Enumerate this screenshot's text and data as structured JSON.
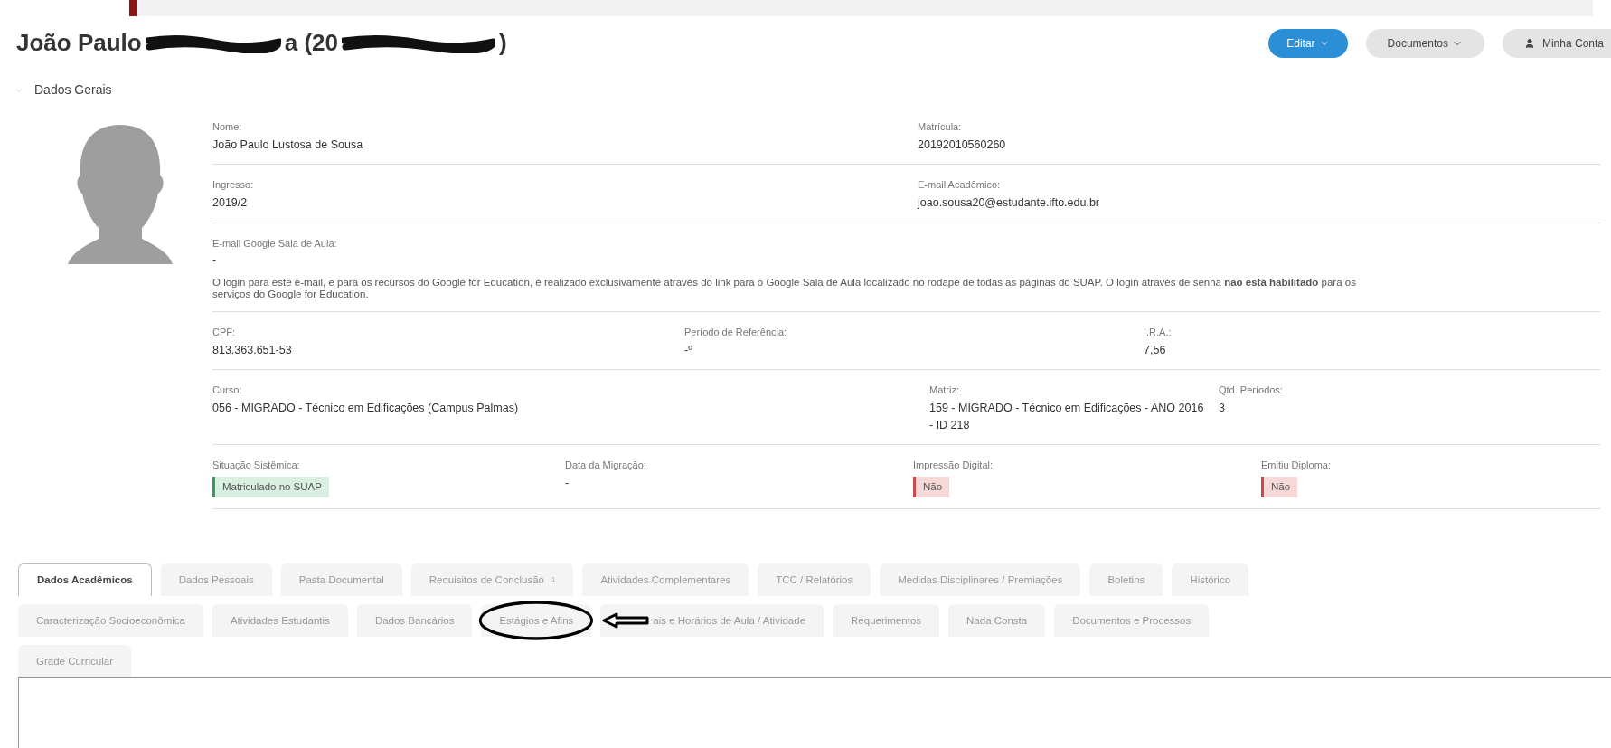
{
  "header": {
    "title_parts": [
      "João Paulo",
      "a (20",
      ")"
    ],
    "buttons": [
      {
        "label": "Editar",
        "kind": "primary"
      },
      {
        "label": "Documentos",
        "kind": "dropdown"
      },
      {
        "label": "Minha Conta",
        "kind": "account"
      }
    ]
  },
  "section": {
    "title": "Dados Gerais",
    "expanded": true
  },
  "rows": [
    {
      "fields": [
        {
          "label": "Nome:",
          "value": "João Paulo Lustosa de Sousa"
        },
        {
          "label": "Matrícula:",
          "value": "20192010560260"
        }
      ]
    },
    {
      "fields": [
        {
          "label": "Ingresso:",
          "value": "2019/2"
        },
        {
          "label": "E-mail Acadêmico:",
          "value": "joao.sousa20@estudante.ifto.edu.br"
        }
      ]
    },
    {
      "fields": [
        {
          "label": "E-mail Google Sala de Aula:",
          "value": "-",
          "note": "O login para este e-mail, e para os recursos do Google for Education, é realizado exclusivamente através do link para o Google Sala de Aula localizado no rodapé de todas as páginas do SUAP. O login através de senha **não está habilitado** para os serviços do Google for Education."
        }
      ]
    },
    {
      "fields": [
        {
          "label": "CPF:",
          "value": "813.363.651-53"
        },
        {
          "label": "Período de Referência:",
          "value": "-º"
        },
        {
          "label": "I.R.A.:",
          "value": "7,56"
        }
      ]
    },
    {
      "fields": [
        {
          "label": "Curso:",
          "value": "056 - MIGRADO - Técnico em Edificações (Campus Palmas)"
        },
        {
          "label": "Matriz:",
          "value": "159 - MIGRADO - Técnico em Edificações - ANO 2016 - ID 218"
        },
        {
          "label": "Qtd. Períodos:",
          "value": "3"
        }
      ]
    },
    {
      "fields": [
        {
          "label": "Situação Sistêmica:",
          "value": "Matriculado no SUAP",
          "kind": "success"
        },
        {
          "label": "Data da Migração:",
          "value": "-"
        },
        {
          "label": "Impressão Digital:",
          "value": "Não",
          "kind": "error"
        },
        {
          "label": "Emitiu Diploma:",
          "value": "Não",
          "kind": "error"
        }
      ]
    }
  ],
  "tab_rows": [
    [
      {
        "label": "Dados Acadêmicos",
        "selected": true,
        "circled": false
      },
      {
        "label": "Dados Pessoais",
        "selected": false,
        "circled": false
      },
      {
        "label": "Pasta Documental",
        "selected": false,
        "circled": false
      },
      {
        "label": "Requisitos de Conclusão",
        "badge": "1",
        "selected": false,
        "circled": false
      },
      {
        "label": "Atividades Complementares",
        "selected": false,
        "circled": false
      },
      {
        "label": "TCC / Relatórios",
        "selected": false,
        "circled": false
      },
      {
        "label": "Medidas Disciplinares / Premiações",
        "selected": false,
        "circled": false
      },
      {
        "label": "Boletins",
        "selected": false,
        "circled": false
      },
      {
        "label": "Histórico",
        "selected": false,
        "circled": false
      }
    ],
    [
      {
        "label": "Caracterização Socioeconômica",
        "selected": false,
        "circled": false
      },
      {
        "label": "Atividades Estudantis",
        "selected": false,
        "circled": false
      },
      {
        "label": "Dados Bancários",
        "selected": false,
        "circled": false
      },
      {
        "label": "Estágios e Afins",
        "selected": false,
        "circled": true
      },
      {
        "label": "ais e Horários de Aula / Atividade",
        "selected": false,
        "circled": false
      },
      {
        "label": "Requerimentos",
        "selected": false,
        "circled": false
      },
      {
        "label": "Nada Consta",
        "selected": false,
        "circled": false
      },
      {
        "label": "Documentos e Processos",
        "selected": false,
        "circled": false
      }
    ],
    [
      {
        "label": "Grade Curricular",
        "selected": false,
        "circled": false
      }
    ]
  ]
}
